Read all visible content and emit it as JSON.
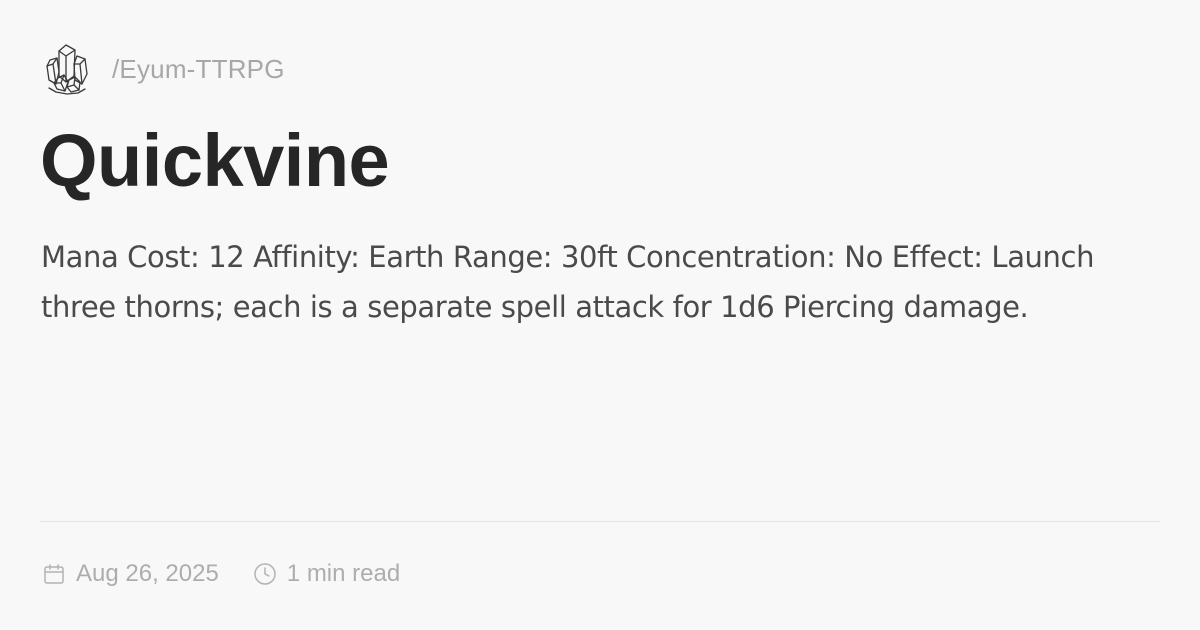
{
  "site": {
    "logo_icon": "crystal-cluster-icon",
    "path": "/Eyum-TTRPG"
  },
  "page": {
    "title": "Quickvine",
    "description": "Mana Cost: 12 Affinity: Earth Range: 30ft Concentration: No Effect: Launch three thorns; each is a separate spell attack for 1d6 Piercing damage."
  },
  "meta": {
    "date_icon": "calendar-icon",
    "date": "Aug 26, 2025",
    "read_icon": "clock-icon",
    "read_time": "1 min read"
  },
  "colors": {
    "background": "#f9f8f9",
    "title": "#262626",
    "body_text": "#4a4a4a",
    "muted_text": "#a8a7a8",
    "divider": "#e4e3e4"
  }
}
